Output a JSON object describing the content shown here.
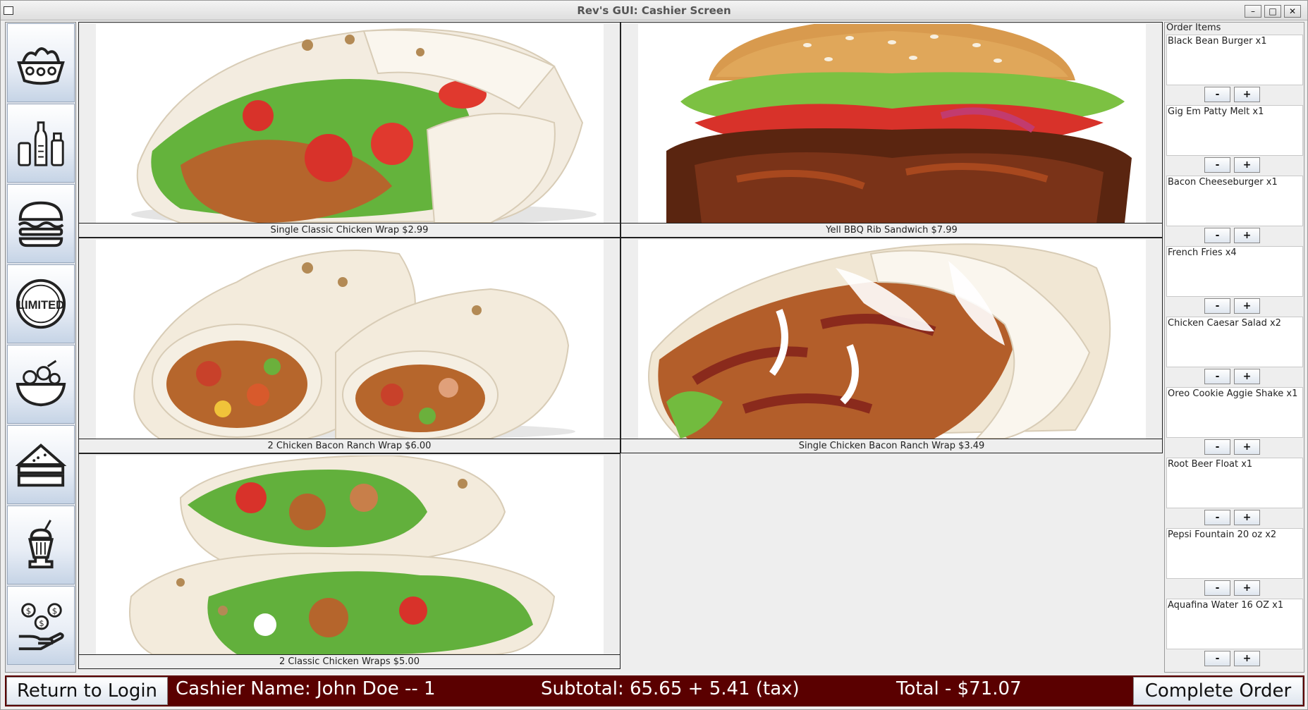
{
  "window": {
    "title": "Rev's GUI: Cashier Screen",
    "min_label": "–",
    "max_label": "□",
    "close_label": "✕"
  },
  "sidebar": {
    "categories": [
      {
        "name": "bowls",
        "icon": "bowl-icon"
      },
      {
        "name": "drinks",
        "icon": "bottles-icon"
      },
      {
        "name": "burgers",
        "icon": "burger-icon"
      },
      {
        "name": "limited",
        "icon": "limited-badge-icon",
        "label": "LIMITED"
      },
      {
        "name": "salads",
        "icon": "salad-icon"
      },
      {
        "name": "sandwiches",
        "icon": "sandwich-icon"
      },
      {
        "name": "shakes",
        "icon": "milkshake-icon"
      },
      {
        "name": "value",
        "icon": "money-hand-icon"
      }
    ]
  },
  "menu": {
    "items": [
      {
        "caption": "Single Classic Chicken Wrap  $2.99",
        "image": "chicken-wrap"
      },
      {
        "caption": "Yell BBQ Rib Sandwich  $7.99",
        "image": "bbq-rib-sandwich"
      },
      {
        "caption": "2 Chicken Bacon Ranch Wrap  $6.00",
        "image": "two-bacon-ranch-wraps"
      },
      {
        "caption": "Single Chicken Bacon Ranch Wrap  $3.49",
        "image": "bacon-ranch-wrap"
      },
      {
        "caption": "2 Classic Chicken Wraps  $5.00",
        "image": "two-classic-wraps"
      }
    ]
  },
  "order": {
    "header": "Order Items",
    "minus_label": "-",
    "plus_label": "+",
    "items": [
      {
        "text": "Black Bean Burger x1"
      },
      {
        "text": "Gig Em Patty Melt x1"
      },
      {
        "text": "Bacon Cheeseburger x1"
      },
      {
        "text": "French Fries x4"
      },
      {
        "text": "Chicken Caesar Salad x2"
      },
      {
        "text": "Oreo Cookie Aggie Shake x1"
      },
      {
        "text": "Root Beer Float x1"
      },
      {
        "text": "Pepsi Fountain 20 oz x2"
      },
      {
        "text": "Aquafina Water 16 OZ x1"
      }
    ]
  },
  "footer": {
    "return_label": "Return to Login",
    "cashier": "Cashier Name: John Doe -- 1",
    "subtotal": "Subtotal: 65.65 +  5.41 (tax)",
    "total": "Total - $71.07",
    "complete_label": "Complete Order"
  },
  "colors": {
    "footer_bg": "#5a0000",
    "button_grad_bottom": "#dfe6ef"
  }
}
